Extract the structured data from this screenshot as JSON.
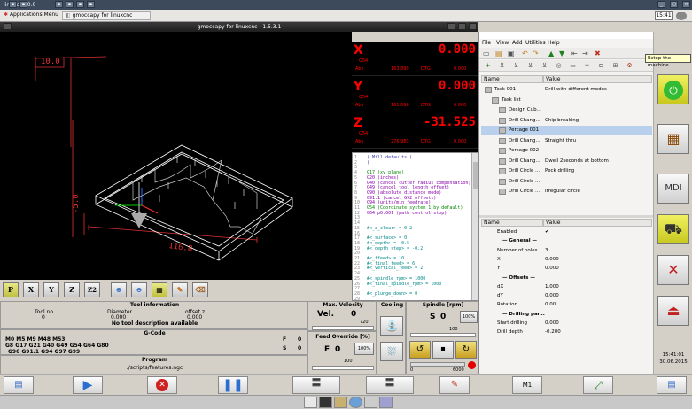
{
  "top_bar": {
    "title": "linuxcnc:0.0"
  },
  "panel_bar": {
    "apps_menu": "Applications Menu",
    "task_label": "gmoccapy for linuxcnc",
    "clock": "15:41"
  },
  "window": {
    "title": "gmoccapy for linuxcnc",
    "version": "1.5.3.1"
  },
  "dro": {
    "rows": [
      {
        "axis": "X",
        "value": "0.000",
        "cs": "G54",
        "abs_label": "Abs",
        "abs_value": "163.899",
        "dtg_label": "DTG",
        "dtg_value": "0.000"
      },
      {
        "axis": "Y",
        "value": "0.000",
        "cs": "G54",
        "abs_label": "Abs",
        "abs_value": "161.896",
        "dtg_label": "DTG",
        "dtg_value": "0.000"
      },
      {
        "axis": "Z",
        "value": "-31.525",
        "cs": "G54",
        "abs_label": "Abs",
        "abs_value": "276.983",
        "dtg_label": "DTG",
        "dtg_value": "0.000"
      }
    ]
  },
  "gcode_view": {
    "line_numbers": [
      "1",
      "2",
      "3",
      "4",
      "5",
      "6",
      "7",
      "8",
      "9",
      "10",
      "11",
      "12",
      "13",
      "14",
      "15",
      "16",
      "17",
      "18",
      "19",
      "20",
      "21",
      "22",
      "23",
      "24",
      "25",
      "26",
      "27",
      "28",
      "29"
    ],
    "lines": [
      {
        "t": "( Mill defaults )",
        "c": "#3a3ab0"
      },
      {
        "t": "(",
        "c": "#3a3ab0"
      },
      {
        "t": "",
        "c": "#000"
      },
      {
        "t": "G17 (xy plane)",
        "c": "#008800"
      },
      {
        "t": "G20 (inches)",
        "c": "#8800aa"
      },
      {
        "t": "G40 (cancel cutter radius compensation)",
        "c": "#8800aa"
      },
      {
        "t": "G49 (cancel tool length offset)",
        "c": "#8800aa"
      },
      {
        "t": "G90 (absolute distance mode)",
        "c": "#8800aa"
      },
      {
        "t": "G91.1 (cancel G92 offsets)",
        "c": "#8800aa"
      },
      {
        "t": "G94 (units/min feedrate)",
        "c": "#8800aa"
      },
      {
        "t": "G54 (Coordinate system 1 by default)",
        "c": "#008800"
      },
      {
        "t": "G64 p0.001 (path control stop)",
        "c": "#8800aa"
      },
      {
        "t": "",
        "c": "#000"
      },
      {
        "t": "",
        "c": "#000"
      },
      {
        "t": "#<_z_clear> = 0.2",
        "c": "#008888"
      },
      {
        "t": "",
        "c": "#000"
      },
      {
        "t": "#<_surface> = 0",
        "c": "#008888"
      },
      {
        "t": "#<_depth> = -0.5",
        "c": "#008888"
      },
      {
        "t": "#<_depth_step> = -0.2",
        "c": "#008888"
      },
      {
        "t": "",
        "c": "#000"
      },
      {
        "t": "#<_ffeed> = 10",
        "c": "#008888"
      },
      {
        "t": "#<_final_feed> = 6",
        "c": "#008888"
      },
      {
        "t": "#<_vertical_feed> = 2",
        "c": "#008888"
      },
      {
        "t": "",
        "c": "#000"
      },
      {
        "t": "#<_spindle_rpm> = 1000",
        "c": "#008888"
      },
      {
        "t": "#<_final_spindle_rpm> = 1000",
        "c": "#008888"
      },
      {
        "t": "",
        "c": "#000"
      },
      {
        "t": "#<_plunge_down> = 0",
        "c": "#008888"
      },
      {
        "t": "",
        "c": "#000"
      }
    ]
  },
  "view_buttons": [
    "P",
    "X",
    "Y",
    "Z",
    "Z2"
  ],
  "menu": [
    "File",
    "View",
    "Add",
    "Utilities",
    "Help"
  ],
  "task_tree": {
    "header_name": "Name",
    "header_value": "Value",
    "rows": [
      {
        "name": "Task 001",
        "value": "Drill with different modes",
        "indent": 0
      },
      {
        "name": "Task list",
        "value": "",
        "indent": 1
      },
      {
        "name": "Design Cub...",
        "value": "",
        "indent": 2
      },
      {
        "name": "Drill Chang...",
        "value": "Chip breaking",
        "indent": 2
      },
      {
        "name": "Percage 001",
        "value": "",
        "indent": 2,
        "selected": true
      },
      {
        "name": "Drill Chang...",
        "value": "Straight thru",
        "indent": 2
      },
      {
        "name": "Percage 002",
        "value": "",
        "indent": 2
      },
      {
        "name": "Drill Chang...",
        "value": "Dwell 2seconds at bottom",
        "indent": 2
      },
      {
        "name": "Drill Circle ...",
        "value": "Peck drilling",
        "indent": 2
      },
      {
        "name": "Drill Circle ...",
        "value": "",
        "indent": 2
      },
      {
        "name": "Drill Circle ...",
        "value": "Irregular circle",
        "indent": 2
      }
    ]
  },
  "props": {
    "header_name": "Name",
    "header_value": "Value",
    "rows": [
      {
        "name": "Enabled",
        "value": "✔",
        "bold": false
      },
      {
        "name": "— General —",
        "value": "",
        "bold": true
      },
      {
        "name": "Number of holes",
        "value": "3",
        "bold": false
      },
      {
        "name": "X",
        "value": "0.000",
        "bold": false
      },
      {
        "name": "Y",
        "value": "0.000",
        "bold": false
      },
      {
        "name": "— Offsets —",
        "value": "",
        "bold": true
      },
      {
        "name": "dX",
        "value": "1.000",
        "bold": false
      },
      {
        "name": "dY",
        "value": "0.000",
        "bold": false
      },
      {
        "name": "Rotation",
        "value": "0.00",
        "bold": false
      },
      {
        "name": "— Drilling par...",
        "value": "",
        "bold": true
      },
      {
        "name": "Start drilling",
        "value": "0.000",
        "bold": false
      },
      {
        "name": "Drill depth",
        "value": "-0.200",
        "bold": false
      }
    ]
  },
  "tool_info": {
    "title": "Tool information",
    "tool_no_label": "Tool no.",
    "tool_no": "0",
    "diameter_label": "Diameter",
    "diameter": "0.000",
    "offset_label": "offset z",
    "offset": "0.000",
    "desc": "No tool description available"
  },
  "gcode_box": {
    "title": "G-Code",
    "lines": [
      "M0 M5 M9 M48 M53",
      "G8 G17 G21 G40 G49 G54 G64 G80",
      "G90 G91.1 G94 G97 G99"
    ],
    "f_label": "F",
    "f_value": "0",
    "s_label": "S",
    "s_value": "0"
  },
  "program": {
    "title": "Program",
    "path": "./scripts/features.ngc"
  },
  "max_velocity": {
    "title": "Max. Velocity",
    "label": "Vel.",
    "value": "0",
    "scale": "720"
  },
  "feed_override": {
    "title": "Feed Override [%]",
    "label": "F",
    "value": "0",
    "percent": "100%",
    "scale": "100"
  },
  "cooling": {
    "title": "Cooling"
  },
  "spindle": {
    "title": "Spindle [rpm]",
    "label": "S",
    "value": "0",
    "percent": "100%",
    "scale": "100",
    "min": "0",
    "max": "6000"
  },
  "sidebar": {
    "tooltip": "Estop the machine",
    "clock": "15:41:01",
    "date": "30.06.2015"
  },
  "bottom_bar": {
    "m1": "M1"
  },
  "colors": {
    "dro_red": "#ff0000",
    "estop_green": "#33cc33",
    "estop_yellow": "#e8e83c",
    "tool_path": "#e03030"
  }
}
